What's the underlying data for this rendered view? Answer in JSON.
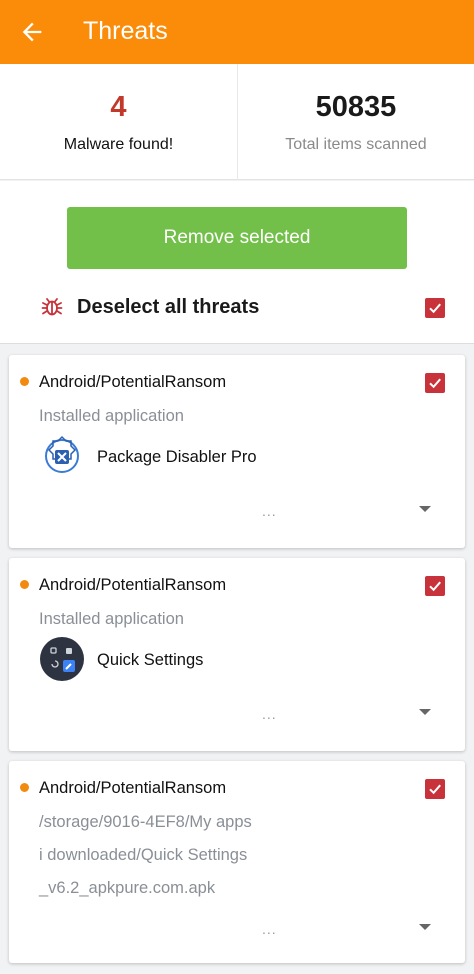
{
  "header": {
    "title": "Threats",
    "back_icon": "arrow-left-icon",
    "color": "#fb8c0a"
  },
  "summary": {
    "malware_count": "4",
    "malware_label": "Malware found!",
    "scanned_count": "50835",
    "scanned_label": "Total items scanned"
  },
  "actions": {
    "remove_label": "Remove selected",
    "deselect_label": "Deselect all threats",
    "deselect_checked": true
  },
  "threats": [
    {
      "name": "Android/PotentialRansom",
      "lines": [
        "Installed application"
      ],
      "app_name": "Package Disabler Pro",
      "app_icon": "package-disabler-icon",
      "more": "...",
      "checked": true
    },
    {
      "name": "Android/PotentialRansom",
      "lines": [
        "Installed application"
      ],
      "app_name": "Quick Settings",
      "app_icon": "quick-settings-icon",
      "more": "...",
      "checked": true
    },
    {
      "name": "Android/PotentialRansom",
      "lines": [
        "/storage/9016-4EF8/My apps",
        "i downloaded/Quick Settings",
        "_v6.2_apkpure.com.apk"
      ],
      "more": "...",
      "checked": true
    }
  ]
}
